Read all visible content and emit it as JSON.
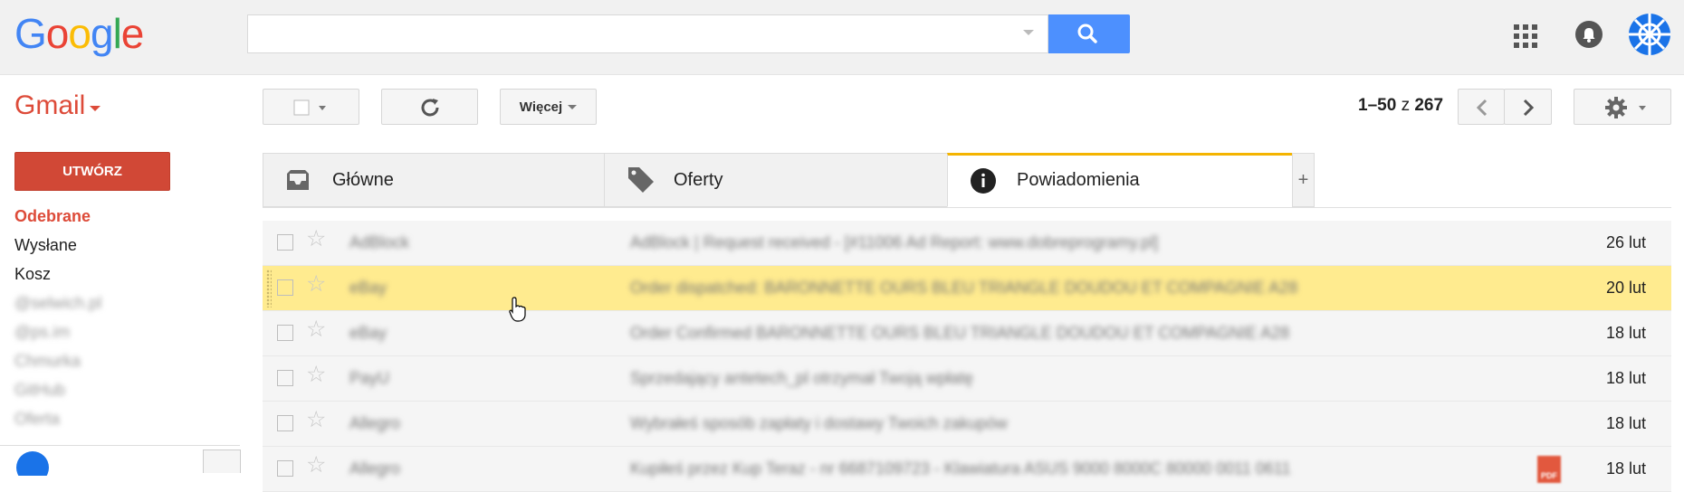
{
  "header": {
    "logo_letters": [
      {
        "ch": "G",
        "color": "#4285f4"
      },
      {
        "ch": "o",
        "color": "#ea4335"
      },
      {
        "ch": "o",
        "color": "#fbbc05"
      },
      {
        "ch": "g",
        "color": "#4285f4"
      },
      {
        "ch": "l",
        "color": "#34a853"
      },
      {
        "ch": "e",
        "color": "#ea4335"
      }
    ],
    "search_value": "",
    "icons": [
      "search-icon",
      "apps-grid-icon",
      "notifications-bell-icon",
      "account-avatar-icon"
    ]
  },
  "toolbar": {
    "app_name": "Gmail",
    "more_label": "Więcej",
    "pager": {
      "range": "1–50",
      "of": "z",
      "total": "267"
    }
  },
  "sidebar": {
    "compose_label": "UTWÓRZ",
    "items": [
      {
        "label": "Odebrane",
        "active": true
      },
      {
        "label": "Wysłane",
        "active": false
      },
      {
        "label": "Kosz",
        "active": false
      },
      {
        "label": "@selwich.pl",
        "blurred": true
      },
      {
        "label": "@ps.im",
        "blurred": true
      },
      {
        "label": "Chmurka",
        "blurred": true
      },
      {
        "label": "GitHub",
        "blurred": true
      },
      {
        "label": "Oferta",
        "blurred": true
      }
    ]
  },
  "tabs": [
    {
      "label": "Główne",
      "icon": "inbox-tray-icon",
      "active": false
    },
    {
      "label": "Oferty",
      "icon": "tag-icon",
      "active": false
    },
    {
      "label": "Powiadomienia",
      "icon": "info-icon",
      "active": true
    }
  ],
  "tab_add_label": "+",
  "messages": [
    {
      "sender": "AdBlock",
      "subject": "AdBlock | Request received - [#11006 Ad Report: www.dobreprogramy.pl]",
      "date": "26 lut",
      "selected": false,
      "attachment": false
    },
    {
      "sender": "eBay",
      "subject": "Order dispatched: BARONNETTE OURS BLEU TRIANGLE DOUDOU ET COMPAGNIE A28",
      "date": "20 lut",
      "selected": true,
      "attachment": false
    },
    {
      "sender": "eBay",
      "subject": "Order Confirmed BARONNETTE OURS BLEU TRIANGLE DOUDOU ET COMPAGNIE A28",
      "date": "18 lut",
      "selected": false,
      "attachment": false
    },
    {
      "sender": "PayU",
      "subject": "Sprzedający antetech_pl otrzymał Twoją wpłatę",
      "date": "18 lut",
      "selected": false,
      "attachment": false
    },
    {
      "sender": "Allegro",
      "subject": "Wybrałeś sposób zapłaty i dostawy Twoich zakupów",
      "date": "18 lut",
      "selected": false,
      "attachment": false
    },
    {
      "sender": "Allegro",
      "subject": "Kupiłeś przez Kup Teraz - nr 6687109723 - Klawiatura ASUS 9000 8000C 80000 0011 0611",
      "date": "18 lut",
      "selected": false,
      "attachment": true,
      "attachment_label": "PDF"
    }
  ],
  "colors": {
    "accent": "#dd4b39",
    "search_button": "#4d90fe",
    "selected_row": "#ffeb8f",
    "active_tab": "#f4b400"
  }
}
